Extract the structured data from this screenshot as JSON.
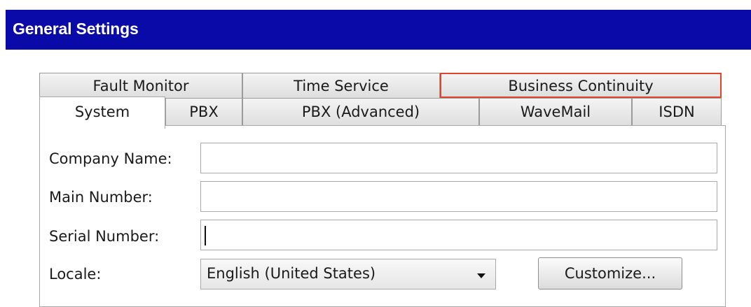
{
  "window": {
    "title": "General Settings"
  },
  "tabs": {
    "row1": [
      {
        "label": "Fault Monitor"
      },
      {
        "label": "Time Service"
      },
      {
        "label": "Business Continuity",
        "highlighted": true
      }
    ],
    "row2": [
      {
        "label": "System",
        "active": true
      },
      {
        "label": "PBX"
      },
      {
        "label": "PBX (Advanced)"
      },
      {
        "label": "WaveMail"
      },
      {
        "label": "ISDN"
      }
    ]
  },
  "form": {
    "company_name": {
      "label": "Company Name:",
      "value": ""
    },
    "main_number": {
      "label": "Main Number:",
      "value": ""
    },
    "serial_number": {
      "label": "Serial Number:",
      "value": ""
    },
    "locale": {
      "label": "Locale:",
      "selected": "English (United States)"
    },
    "customize_button": "Customize..."
  },
  "colors": {
    "titlebar": "#0a0aa8",
    "highlight_border": "#e0452c"
  }
}
